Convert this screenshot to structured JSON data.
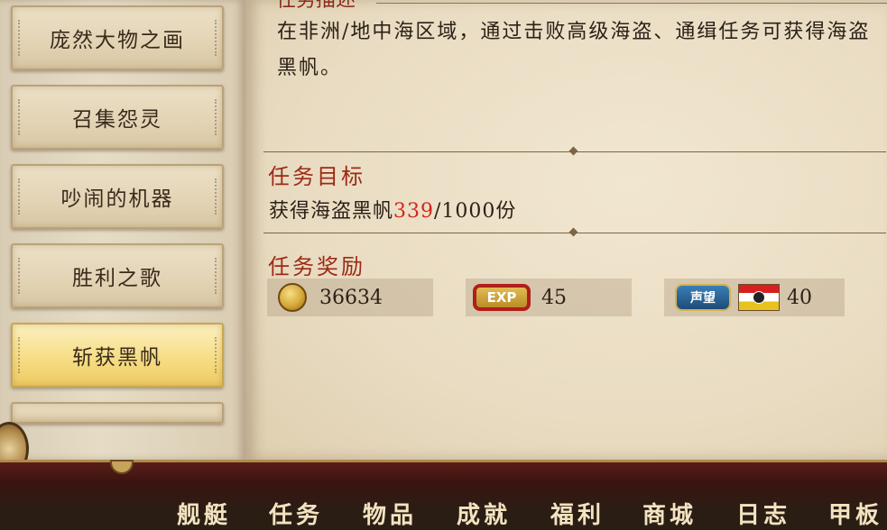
{
  "sidebar": {
    "items": [
      {
        "label": "庞然大物之画",
        "active": false
      },
      {
        "label": "召集怨灵",
        "active": false
      },
      {
        "label": "吵闹的机器",
        "active": false
      },
      {
        "label": "胜利之歌",
        "active": false
      },
      {
        "label": "斩获黑帆",
        "active": true
      }
    ]
  },
  "quest": {
    "description_heading": "任务描述",
    "description": "在非洲/地中海区域，通过击败高级海盗、通缉任务可获得海盗黑帆。",
    "goal_title": "任务目标",
    "goal_prefix": "获得海盗黑帆",
    "goal_progress": "339",
    "goal_suffix": "/1000份",
    "reward_title": "任务奖励",
    "rewards": {
      "gold": "36634",
      "exp_label": "EXP",
      "exp": "45",
      "reputation_label": "声望",
      "reputation": "40"
    }
  },
  "bottom_nav": [
    "舰艇",
    "任务",
    "物品",
    "成就",
    "福利",
    "商城",
    "日志",
    "甲板"
  ],
  "colors": {
    "accent_red": "#d4261a",
    "title_red": "#9b2a16",
    "active_tab": "#f6dd86"
  }
}
